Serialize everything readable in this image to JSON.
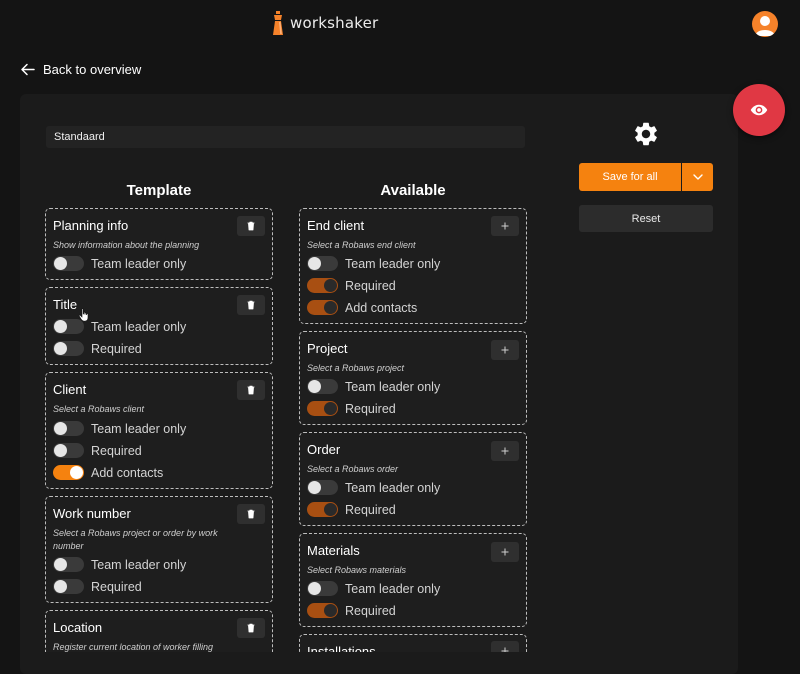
{
  "app": {
    "brand": "workshaker"
  },
  "nav": {
    "back_label": "Back to overview"
  },
  "form": {
    "template_name": "Standaard"
  },
  "actions": {
    "save_label": "Save for all",
    "reset_label": "Reset"
  },
  "columns": {
    "template_title": "Template",
    "available_title": "Available"
  },
  "template_cards": [
    {
      "title": "Planning info",
      "description": "Show information about the planning",
      "action_icon": "trash-icon",
      "toggles": [
        {
          "label": "Team leader only",
          "state": "off"
        }
      ]
    },
    {
      "title": "Title",
      "description": "",
      "action_icon": "trash-icon",
      "toggles": [
        {
          "label": "Team leader only",
          "state": "off"
        },
        {
          "label": "Required",
          "state": "off"
        }
      ]
    },
    {
      "title": "Client",
      "description": "Select a Robaws client",
      "action_icon": "trash-icon",
      "toggles": [
        {
          "label": "Team leader only",
          "state": "off"
        },
        {
          "label": "Required",
          "state": "off"
        },
        {
          "label": "Add contacts",
          "state": "on"
        }
      ]
    },
    {
      "title": "Work number",
      "description": "Select a Robaws project or order by work number",
      "action_icon": "trash-icon",
      "toggles": [
        {
          "label": "Team leader only",
          "state": "off"
        },
        {
          "label": "Required",
          "state": "off"
        }
      ]
    },
    {
      "title": "Location",
      "description": "Register current location of worker filling",
      "action_icon": "trash-icon",
      "toggles": []
    }
  ],
  "available_cards": [
    {
      "title": "End client",
      "description": "Select a Robaws end client",
      "action_icon": "plus-icon",
      "toggles": [
        {
          "label": "Team leader only",
          "state": "off"
        },
        {
          "label": "Required",
          "state": "on"
        },
        {
          "label": "Add contacts",
          "state": "on"
        }
      ]
    },
    {
      "title": "Project",
      "description": "Select a Robaws project",
      "action_icon": "plus-icon",
      "toggles": [
        {
          "label": "Team leader only",
          "state": "off"
        },
        {
          "label": "Required",
          "state": "on"
        }
      ]
    },
    {
      "title": "Order",
      "description": "Select a Robaws order",
      "action_icon": "plus-icon",
      "toggles": [
        {
          "label": "Team leader only",
          "state": "off"
        },
        {
          "label": "Required",
          "state": "on"
        }
      ]
    },
    {
      "title": "Materials",
      "description": "Select Robaws materials",
      "action_icon": "plus-icon",
      "toggles": [
        {
          "label": "Team leader only",
          "state": "off"
        },
        {
          "label": "Required",
          "state": "on"
        }
      ]
    },
    {
      "title": "Installations",
      "description": "",
      "action_icon": "plus-icon",
      "toggles": []
    }
  ],
  "colors": {
    "accent": "#f5820f",
    "preview": "#e03844",
    "background": "#141414",
    "panel": "#1b1b1b"
  },
  "icons": {
    "back": "arrow-left-icon",
    "settings": "gear-icon",
    "preview": "eye-icon",
    "dropdown": "chevron-down-icon",
    "profile": "user-icon"
  }
}
